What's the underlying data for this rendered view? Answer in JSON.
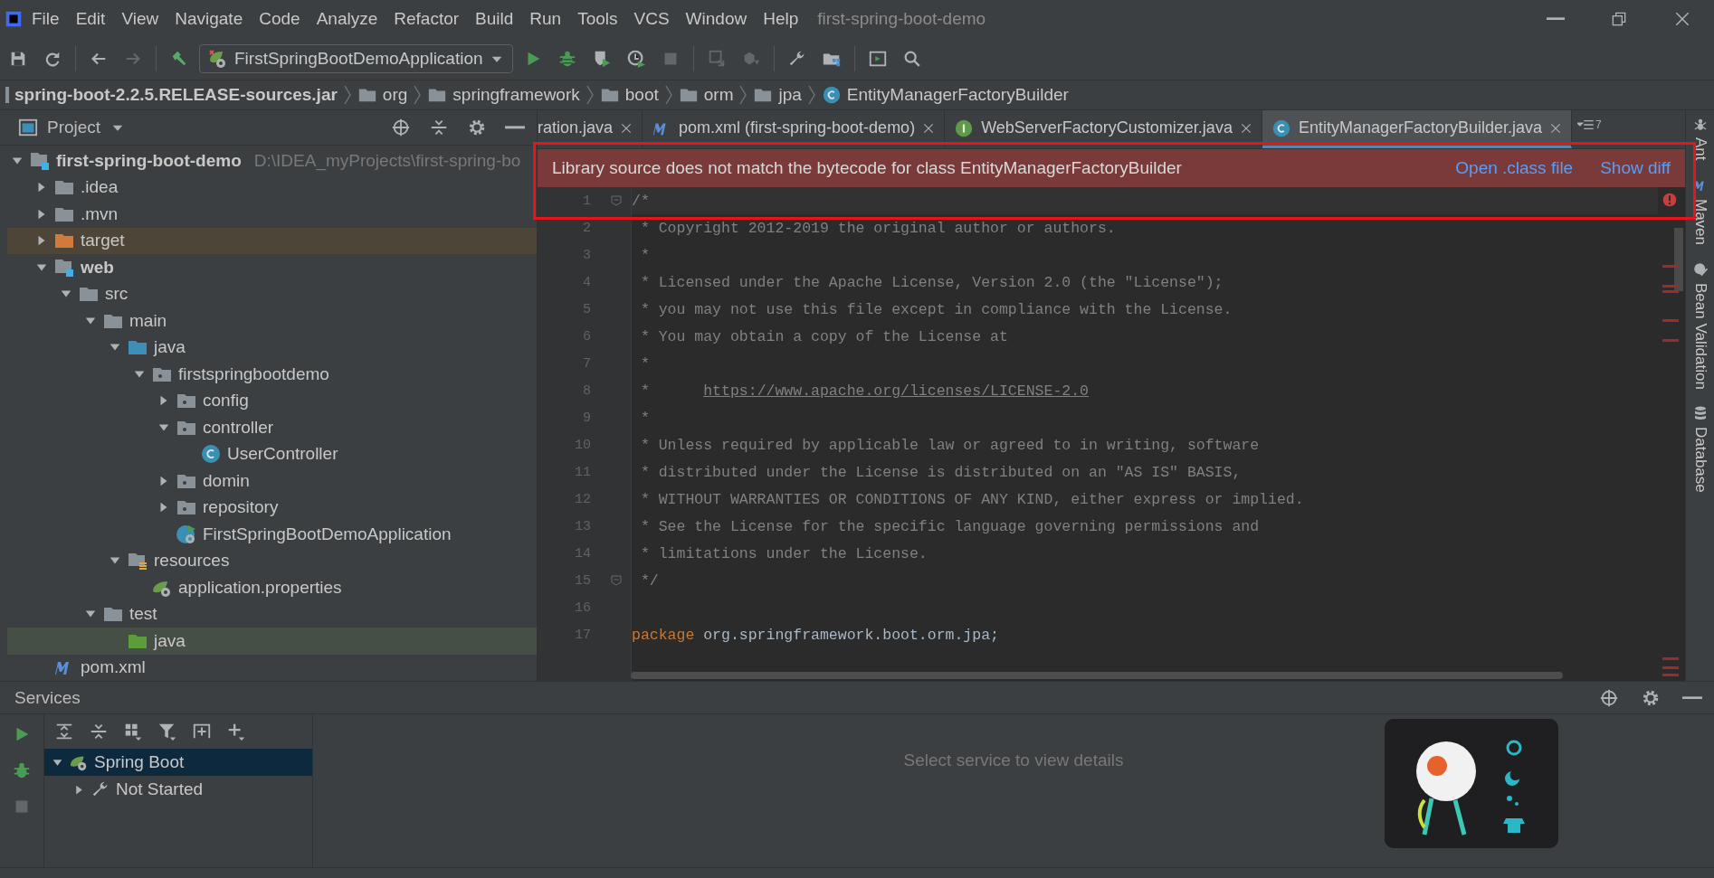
{
  "menu_bar": {
    "items": [
      "File",
      "Edit",
      "View",
      "Navigate",
      "Code",
      "Analyze",
      "Refactor",
      "Build",
      "Run",
      "Tools",
      "VCS",
      "Window",
      "Help"
    ],
    "title": "first-spring-boot-demo"
  },
  "toolbar": {
    "run_config": "FirstSpringBootDemoApplication",
    "buttons": [
      {
        "kind": "save",
        "disabled": false
      },
      {
        "kind": "sync",
        "disabled": false
      },
      {
        "kind": "separator"
      },
      {
        "kind": "back",
        "disabled": false
      },
      {
        "kind": "forward",
        "disabled": true
      },
      {
        "kind": "separator"
      },
      {
        "kind": "build",
        "disabled": false
      },
      {
        "kind": "config"
      },
      {
        "kind": "run",
        "disabled": false
      },
      {
        "kind": "debug",
        "disabled": false
      },
      {
        "kind": "coverage",
        "disabled": false
      },
      {
        "kind": "profile",
        "disabled": false
      },
      {
        "kind": "stop",
        "disabled": true
      },
      {
        "kind": "separator"
      },
      {
        "kind": "update",
        "disabled": true
      },
      {
        "kind": "push",
        "disabled": true
      },
      {
        "kind": "separator"
      },
      {
        "kind": "wrench",
        "disabled": false
      },
      {
        "kind": "structure",
        "disabled": false
      },
      {
        "kind": "separator"
      },
      {
        "kind": "terminal",
        "disabled": false
      },
      {
        "kind": "search",
        "disabled": false
      }
    ]
  },
  "breadcrumbs": [
    {
      "kind": "jar",
      "label": "spring-boot-2.2.5.RELEASE-sources.jar"
    },
    {
      "kind": "folder",
      "label": "org"
    },
    {
      "kind": "folder",
      "label": "springframework"
    },
    {
      "kind": "folder",
      "label": "boot"
    },
    {
      "kind": "folder",
      "label": "orm"
    },
    {
      "kind": "folder",
      "label": "jpa"
    },
    {
      "kind": "class",
      "label": "EntityManagerFactoryBuilder"
    }
  ],
  "project": {
    "title": "Project",
    "tree": [
      {
        "label": "first-spring-boot-demo",
        "path": "D:\\IDEA_myProjects\\first-spring-bo",
        "kind": "module",
        "expanded": true,
        "selected": false,
        "children": [
          {
            "label": ".idea",
            "kind": "folder",
            "expanded": false,
            "selected": false
          },
          {
            "label": ".mvn",
            "kind": "folder",
            "expanded": false,
            "selected": false
          },
          {
            "label": "target",
            "kind": "excluded",
            "expanded": false,
            "selected": false
          },
          {
            "label": "web",
            "kind": "module",
            "expanded": true,
            "selected": false,
            "children": [
              {
                "label": "src",
                "kind": "folder",
                "expanded": true,
                "selected": false,
                "children": [
                  {
                    "label": "main",
                    "kind": "folder",
                    "expanded": true,
                    "selected": false,
                    "children": [
                      {
                        "label": "java",
                        "kind": "source",
                        "expanded": true,
                        "selected": false,
                        "children": [
                          {
                            "label": "firstspringbootdemo",
                            "kind": "package",
                            "expanded": true,
                            "selected": false,
                            "children": [
                              {
                                "label": "config",
                                "kind": "package",
                                "expanded": false,
                                "selected": false
                              },
                              {
                                "label": "controller",
                                "kind": "package",
                                "expanded": true,
                                "selected": false,
                                "children": [
                                  {
                                    "label": "UserController",
                                    "kind": "class",
                                    "selected": false
                                  }
                                ]
                              },
                              {
                                "label": "domin",
                                "kind": "package",
                                "expanded": false,
                                "selected": false
                              },
                              {
                                "label": "repository",
                                "kind": "package",
                                "expanded": false,
                                "selected": false
                              },
                              {
                                "label": "FirstSpringBootDemoApplication",
                                "kind": "spring-class",
                                "selected": false
                              }
                            ]
                          }
                        ]
                      },
                      {
                        "label": "resources",
                        "kind": "resources",
                        "expanded": true,
                        "selected": false,
                        "children": [
                          {
                            "label": "application.properties",
                            "kind": "properties",
                            "selected": false
                          }
                        ]
                      }
                    ]
                  },
                  {
                    "label": "test",
                    "kind": "folder",
                    "expanded": true,
                    "selected": false,
                    "children": [
                      {
                        "label": "java",
                        "kind": "test-source",
                        "selected": true
                      }
                    ]
                  }
                ]
              }
            ]
          },
          {
            "label": "pom.xml",
            "kind": "maven",
            "selected": false
          }
        ]
      }
    ]
  },
  "editor": {
    "tabs": [
      {
        "label": "ration.java",
        "kind": "plain",
        "selected": false
      },
      {
        "label": "pom.xml (first-spring-boot-demo)",
        "kind": "maven",
        "selected": false
      },
      {
        "label": "WebServerFactoryCustomizer.java",
        "kind": "interface",
        "selected": false
      },
      {
        "label": "EntityManagerFactoryBuilder.java",
        "kind": "class",
        "selected": true
      }
    ],
    "overflow": "7",
    "banner": {
      "message": "Library source does not match the bytecode for class EntityManagerFactoryBuilder",
      "actions": [
        "Open .class file",
        "Show diff"
      ]
    },
    "lines": [
      {
        "number": "1",
        "fold": true,
        "tokens": [
          {
            "kind": "comment",
            "text": "/*"
          }
        ]
      },
      {
        "number": "2",
        "tokens": [
          {
            "kind": "comment",
            "text": " * Copyright 2012-2019 the original author or authors."
          }
        ]
      },
      {
        "number": "3",
        "tokens": [
          {
            "kind": "comment",
            "text": " *"
          }
        ]
      },
      {
        "number": "4",
        "tokens": [
          {
            "kind": "comment",
            "text": " * Licensed under the Apache License, Version 2.0 (the \"License\");"
          }
        ]
      },
      {
        "number": "5",
        "tokens": [
          {
            "kind": "comment",
            "text": " * you may not use this file except in compliance with the License."
          }
        ]
      },
      {
        "number": "6",
        "tokens": [
          {
            "kind": "comment",
            "text": " * You may obtain a copy of the License at"
          }
        ]
      },
      {
        "number": "7",
        "tokens": [
          {
            "kind": "comment",
            "text": " *"
          }
        ]
      },
      {
        "number": "8",
        "tokens": [
          {
            "kind": "comment",
            "text": " *      "
          },
          {
            "kind": "link",
            "text": "https://www.apache.org/licenses/LICENSE-2.0"
          }
        ]
      },
      {
        "number": "9",
        "tokens": [
          {
            "kind": "comment",
            "text": " *"
          }
        ]
      },
      {
        "number": "10",
        "tokens": [
          {
            "kind": "comment",
            "text": " * Unless required by applicable law or agreed to in writing, software"
          }
        ]
      },
      {
        "number": "11",
        "tokens": [
          {
            "kind": "comment",
            "text": " * distributed under the License is distributed on an \"AS IS\" BASIS,"
          }
        ]
      },
      {
        "number": "12",
        "tokens": [
          {
            "kind": "comment",
            "text": " * WITHOUT WARRANTIES OR CONDITIONS OF ANY KIND, either express or implied."
          }
        ]
      },
      {
        "number": "13",
        "tokens": [
          {
            "kind": "comment",
            "text": " * See the License for the specific language governing permissions and"
          }
        ]
      },
      {
        "number": "14",
        "tokens": [
          {
            "kind": "comment",
            "text": " * limitations under the License."
          }
        ]
      },
      {
        "number": "15",
        "fold": true,
        "tokens": [
          {
            "kind": "comment",
            "text": " */"
          }
        ]
      },
      {
        "number": "16"
      },
      {
        "number": "17",
        "tokens": [
          {
            "kind": "keyword",
            "text": "package"
          },
          {
            "kind": "plain",
            "text": " org.springframework.boot.orm.jpa;"
          }
        ]
      }
    ]
  },
  "tool_windows": [
    {
      "label": "Ant",
      "kind": "ant"
    },
    {
      "label": "Maven",
      "kind": "maven"
    },
    {
      "label": "Bean Validation",
      "kind": "bean"
    },
    {
      "label": "Database",
      "kind": "database"
    }
  ],
  "services": {
    "title": "Services",
    "tree": [
      {
        "label": "Spring Boot",
        "kind": "spring",
        "expanded": true,
        "selected": true,
        "children": [
          {
            "label": "Not Started",
            "kind": "wrench",
            "expanded": false,
            "selected": false
          }
        ]
      }
    ],
    "details": "Select service to view details"
  }
}
